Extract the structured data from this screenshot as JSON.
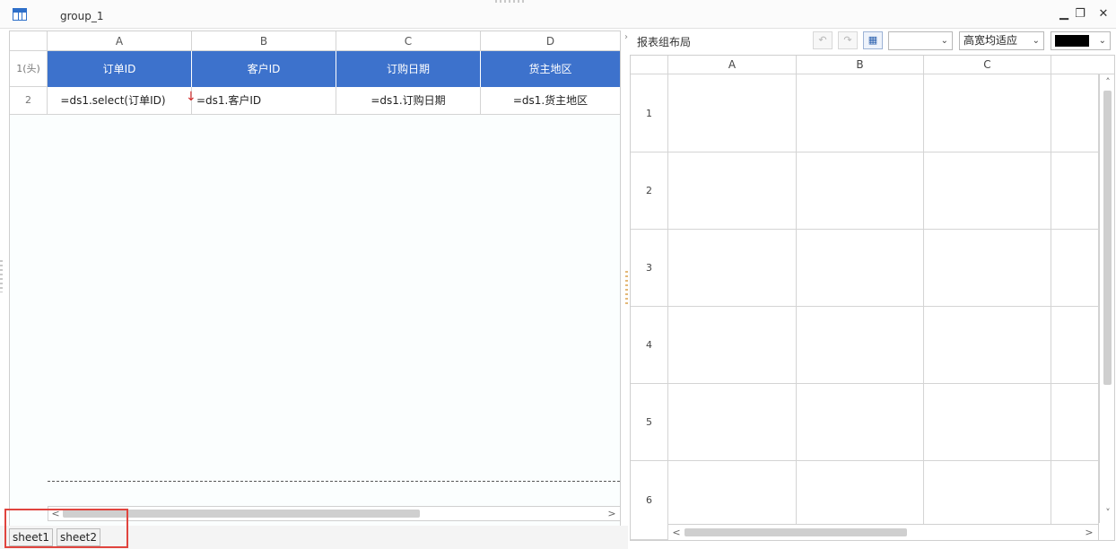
{
  "window": {
    "title": "group_1"
  },
  "left_sheet": {
    "columns": [
      "A",
      "B",
      "C",
      "D"
    ],
    "rows": [
      {
        "label": "1(头)",
        "cells": [
          "订单ID",
          "客户ID",
          "订购日期",
          "货主地区"
        ]
      },
      {
        "label": "2",
        "cells": [
          "=ds1.select(订单ID)",
          "=ds1.客户ID",
          "=ds1.订购日期",
          "=ds1.货主地区"
        ]
      }
    ],
    "expand_marker": "↓"
  },
  "sheet_tabs": [
    "sheet1",
    "sheet2"
  ],
  "right_panel": {
    "title": "报表组布局",
    "fit_mode": "高宽均适应",
    "color_value": "#000000",
    "columns": [
      "A",
      "B",
      "C"
    ],
    "rows": [
      "1",
      "2",
      "3",
      "4",
      "5",
      "6"
    ]
  },
  "colors": {
    "header_fill": "#3d72cc",
    "highlight": "#e0443e",
    "expand_arrow": "#d42b2b"
  },
  "icons": {
    "undo": "undo-icon",
    "redo": "redo-icon",
    "layout": "layout-icon"
  }
}
